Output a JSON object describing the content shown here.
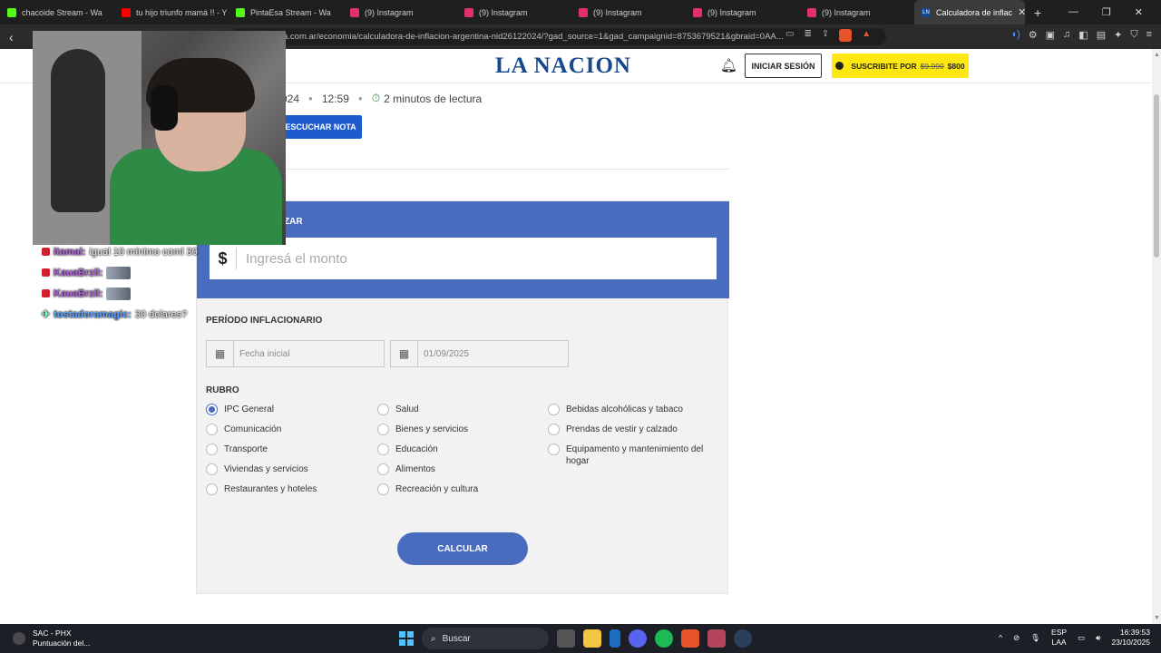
{
  "browser": {
    "tabs": [
      {
        "label": "chacoide Stream - Wa",
        "favcolor": "#53fc18"
      },
      {
        "label": "tu hijo triunfo mamá !! - Y",
        "favcolor": "#ff0000"
      },
      {
        "label": "PintaEsa Stream - Wa",
        "favcolor": "#53fc18"
      },
      {
        "label": "(9) Instagram",
        "favcolor": "#e1306c"
      },
      {
        "label": "(9) Instagram",
        "favcolor": "#e1306c"
      },
      {
        "label": "(9) Instagram",
        "favcolor": "#e1306c"
      },
      {
        "label": "(9) Instagram",
        "favcolor": "#e1306c"
      },
      {
        "label": "(9) Instagram",
        "favcolor": "#e1306c"
      }
    ],
    "active_tab": {
      "label": "Calculadora de inflac",
      "favicon": "LN"
    },
    "url": "a.com.ar/economia/calculadora-de-inflacion-argentina-nid26122024/?gad_source=1&gad_campaignid=8753679521&gbraid=0AA...",
    "brave_count": "1"
  },
  "site": {
    "logo": "LA NACION",
    "login": "INICIAR SESIÓN",
    "subscribe_prefix": "SUSCRIBITE POR",
    "subscribe_old": "$9.990",
    "subscribe_new": "$800",
    "brand_color": "#16488c",
    "accent_yellow": "#ffe711"
  },
  "article": {
    "date_fragment": "024",
    "time": "12:59",
    "read_time": "2 minutos de lectura",
    "listen": "ESCUCHAR NOTA"
  },
  "calculator": {
    "title_fragment": "ZAR",
    "currency": "$",
    "amount_placeholder": "Ingresá el monto",
    "period_label": "PERÍODO INFLACIONARIO",
    "start_placeholder": "Fecha inicial",
    "end_value": "01/09/2025",
    "rubro_label": "RUBRO",
    "selected": "IPC General",
    "col1": [
      "IPC General",
      "Comunicación",
      "Transporte",
      "Viviendas y servicios",
      "Restaurantes y hoteles"
    ],
    "col2": [
      "Salud",
      "Bienes y servicios",
      "Educación",
      "Alimentos",
      "Recreación y cultura"
    ],
    "col3": [
      "Bebidas alcohólicas y tabaco",
      "Prendas de vestir y calzado",
      "Equipamento y mantenimiento del hogar"
    ],
    "button": "CALCULAR",
    "color": "#4a6cbf"
  },
  "chat": [
    {
      "user": "itamal:",
      "msg": "igual 10 mínimo coml 30"
    },
    {
      "user": "KauaBrzil:",
      "msg": ""
    },
    {
      "user": "KauaBrzil:",
      "msg": ""
    },
    {
      "user": "tostadoramagic:",
      "msg": "30 dolares?"
    }
  ],
  "taskbar": {
    "app_title": "SAC - PHX",
    "app_sub": "Puntuación del...",
    "search": "Buscar",
    "lang1": "ESP",
    "lang2": "LAA",
    "time": "16:39:53",
    "date": "23/10/2025"
  }
}
